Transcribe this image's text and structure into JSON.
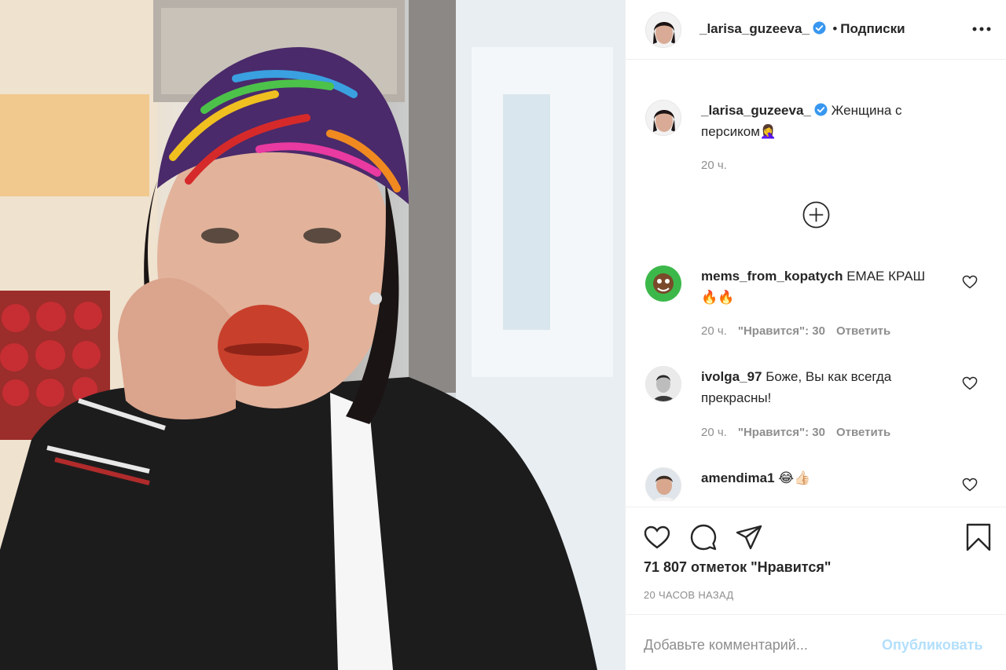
{
  "post": {
    "author": "_larisa_guzeeva_",
    "follow_status": "Подписки",
    "caption_text": "Женщина с персиком",
    "caption_emoji": "🤦‍♀️",
    "caption_time": "20 ч.",
    "likes_count": "71 807 отметок \"Нравится\"",
    "time_ago": "20 ЧАСОВ НАЗАД"
  },
  "comments": [
    {
      "username": "mems_from_kopatych",
      "text": "ЕМАЕ КРАШ",
      "emoji": "🔥🔥",
      "time": "20 ч.",
      "likes": "\"Нравится\": 30",
      "reply": "Ответить"
    },
    {
      "username": "ivolga_97",
      "text": "Боже, Вы как всегда прекрасны!",
      "emoji": "",
      "time": "20 ч.",
      "likes": "\"Нравится\": 30",
      "reply": "Ответить"
    },
    {
      "username": "amendima1",
      "text": "",
      "emoji": "😂👍🏻",
      "time": "",
      "likes": "",
      "reply": ""
    }
  ],
  "composer": {
    "placeholder": "Добавьте комментарий...",
    "publish_label": "Опубликовать"
  },
  "icons": {
    "more": "more-dots-icon",
    "verified": "verified-badge-icon",
    "load_more": "plus-circle-icon",
    "like": "heart-icon",
    "comment": "comment-icon",
    "share": "paper-plane-icon",
    "save": "bookmark-icon"
  },
  "colors": {
    "verified_blue": "#3897f0",
    "publish_disabled": "#b2dffc",
    "secondary_text": "#8e8e8e"
  }
}
